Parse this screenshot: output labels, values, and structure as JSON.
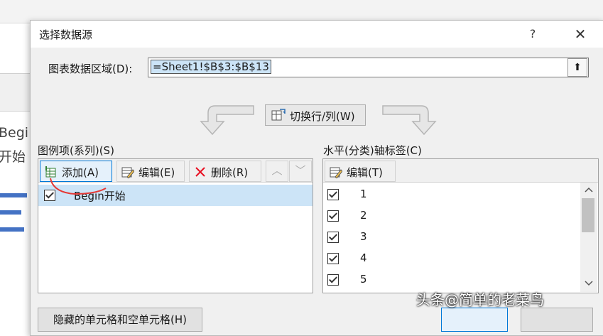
{
  "background": {
    "text_line1": "Begi",
    "text_line2": "开始",
    "series_color": "#4472c4"
  },
  "dialog": {
    "title": "选择数据源",
    "help_symbol": "?",
    "close_symbol": "✕",
    "range_label": "图表数据区域(D):",
    "range_value": "=Sheet1!$B$3:$B$13",
    "collapse_symbol": "⬆",
    "switch_label": "切换行/列(W)",
    "legend": {
      "header": "图例项(系列)(S)",
      "add_label": "添加(A)",
      "edit_label": "编辑(E)",
      "remove_label": "删除(R)",
      "up_symbol": "︿",
      "down_symbol": "﹀",
      "items": [
        {
          "label": "Begin开始",
          "checked": true
        }
      ]
    },
    "axis": {
      "header": "水平(分类)轴标签(C)",
      "edit_label": "编辑(T)",
      "items": [
        {
          "label": "1",
          "checked": true
        },
        {
          "label": "2",
          "checked": true
        },
        {
          "label": "3",
          "checked": true
        },
        {
          "label": "4",
          "checked": true
        },
        {
          "label": "5",
          "checked": true
        }
      ]
    },
    "hidden_cells_label": "隐藏的单元格和空单元格(H)"
  },
  "watermark": "头条@简单的老菜鸟",
  "colors": {
    "accent": "#0078d7",
    "selection": "#cce4f7",
    "red_x": "#e81123"
  }
}
